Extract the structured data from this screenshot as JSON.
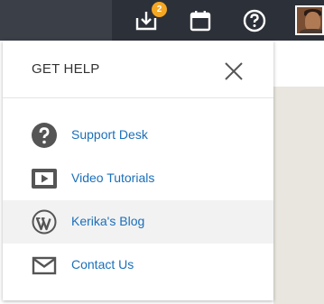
{
  "topbar": {
    "notification_count": "2",
    "icons": [
      "download-icon",
      "calendar-icon",
      "help-icon"
    ],
    "colors": {
      "bar": "#2c3038",
      "badge": "#f5a623"
    }
  },
  "panel": {
    "title": "GET HELP",
    "items": [
      {
        "label": "Support Desk",
        "icon": "question-circle-icon"
      },
      {
        "label": "Video Tutorials",
        "icon": "video-play-icon"
      },
      {
        "label": "Kerika's Blog",
        "icon": "wordpress-icon",
        "highlighted": true
      },
      {
        "label": "Contact Us",
        "icon": "envelope-icon"
      }
    ],
    "colors": {
      "link": "#1a6fba",
      "icon": "#555555",
      "hover_row": "#f2f2f2"
    }
  }
}
